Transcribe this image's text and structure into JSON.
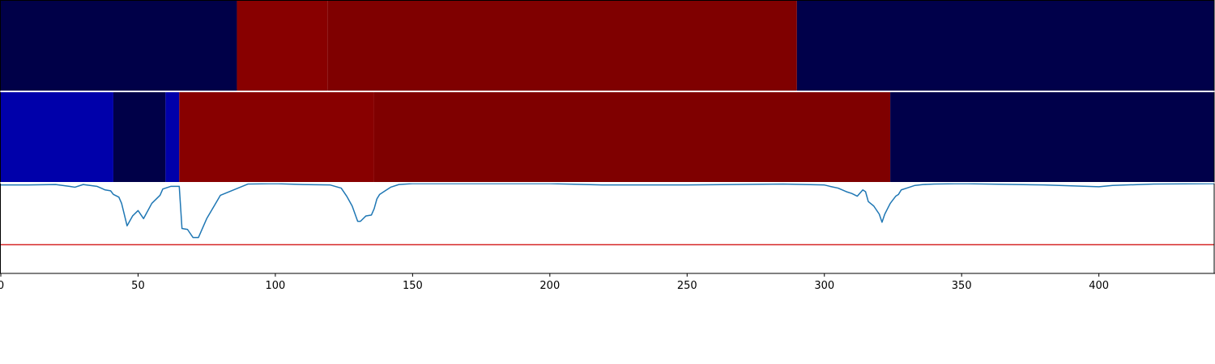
{
  "chart_data": {
    "type": "heatmap",
    "xlim": [
      0,
      442
    ],
    "x_ticks": [
      0,
      50,
      100,
      150,
      200,
      250,
      300,
      350,
      400
    ],
    "x_tick_labels": [
      "0",
      "50",
      "100",
      "150",
      "200",
      "250",
      "300",
      "350",
      "400"
    ],
    "colormap": "seismic",
    "tracks": [
      {
        "segments": [
          {
            "x0": 0,
            "x1": 86,
            "color": "#000048"
          },
          {
            "x0": 86,
            "x1": 119,
            "color": "#880000"
          },
          {
            "x0": 119,
            "x1": 290,
            "color": "#7f0000"
          },
          {
            "x0": 290,
            "x1": 442,
            "color": "#00004a"
          }
        ]
      },
      {
        "segments": [
          {
            "x0": 0,
            "x1": 41,
            "color": "#0000aa"
          },
          {
            "x0": 41,
            "x1": 60,
            "color": "#000048"
          },
          {
            "x0": 60,
            "x1": 65,
            "color": "#0000aa"
          },
          {
            "x0": 65,
            "x1": 136,
            "color": "#880000"
          },
          {
            "x0": 136,
            "x1": 324,
            "color": "#7f0000"
          },
          {
            "x0": 324,
            "x1": 442,
            "color": "#00004a"
          }
        ]
      }
    ],
    "line_panel": {
      "ylim": [
        0,
        1
      ],
      "threshold": 0.32,
      "threshold_color": "#d62728",
      "line_color": "#1f77b4",
      "x": [
        0,
        10,
        20,
        25,
        27,
        30,
        35,
        38,
        40,
        41,
        43,
        44,
        46,
        48,
        50,
        52,
        55,
        58,
        59,
        60,
        61,
        62,
        63,
        64,
        65,
        66,
        68,
        70,
        72,
        75,
        80,
        90,
        100,
        110,
        120,
        124,
        126,
        128,
        130,
        131,
        133,
        135,
        136,
        137,
        138,
        139,
        140,
        142,
        145,
        150,
        200,
        219,
        250,
        285,
        300,
        302,
        305,
        308,
        310,
        312,
        314,
        315,
        316,
        318,
        320,
        321,
        322,
        323,
        324,
        325,
        326,
        327,
        328,
        330,
        333,
        336,
        340,
        350,
        380,
        400,
        405,
        410,
        420,
        442
      ],
      "y": [
        0.985,
        0.985,
        0.99,
        0.97,
        0.96,
        0.99,
        0.97,
        0.93,
        0.92,
        0.88,
        0.85,
        0.78,
        0.53,
        0.64,
        0.7,
        0.61,
        0.78,
        0.87,
        0.94,
        0.95,
        0.96,
        0.97,
        0.97,
        0.97,
        0.97,
        0.5,
        0.49,
        0.4,
        0.4,
        0.61,
        0.87,
        0.995,
        1.0,
        0.99,
        0.985,
        0.95,
        0.86,
        0.75,
        0.58,
        0.58,
        0.64,
        0.65,
        0.72,
        0.83,
        0.88,
        0.9,
        0.92,
        0.96,
        0.99,
        1.0,
        1.0,
        0.985,
        0.985,
        0.995,
        0.985,
        0.97,
        0.95,
        0.91,
        0.89,
        0.86,
        0.93,
        0.91,
        0.8,
        0.75,
        0.66,
        0.57,
        0.66,
        0.72,
        0.78,
        0.82,
        0.86,
        0.88,
        0.93,
        0.95,
        0.98,
        0.99,
        0.995,
        1.0,
        0.985,
        0.965,
        0.98,
        0.985,
        0.995,
        1.0
      ]
    }
  }
}
